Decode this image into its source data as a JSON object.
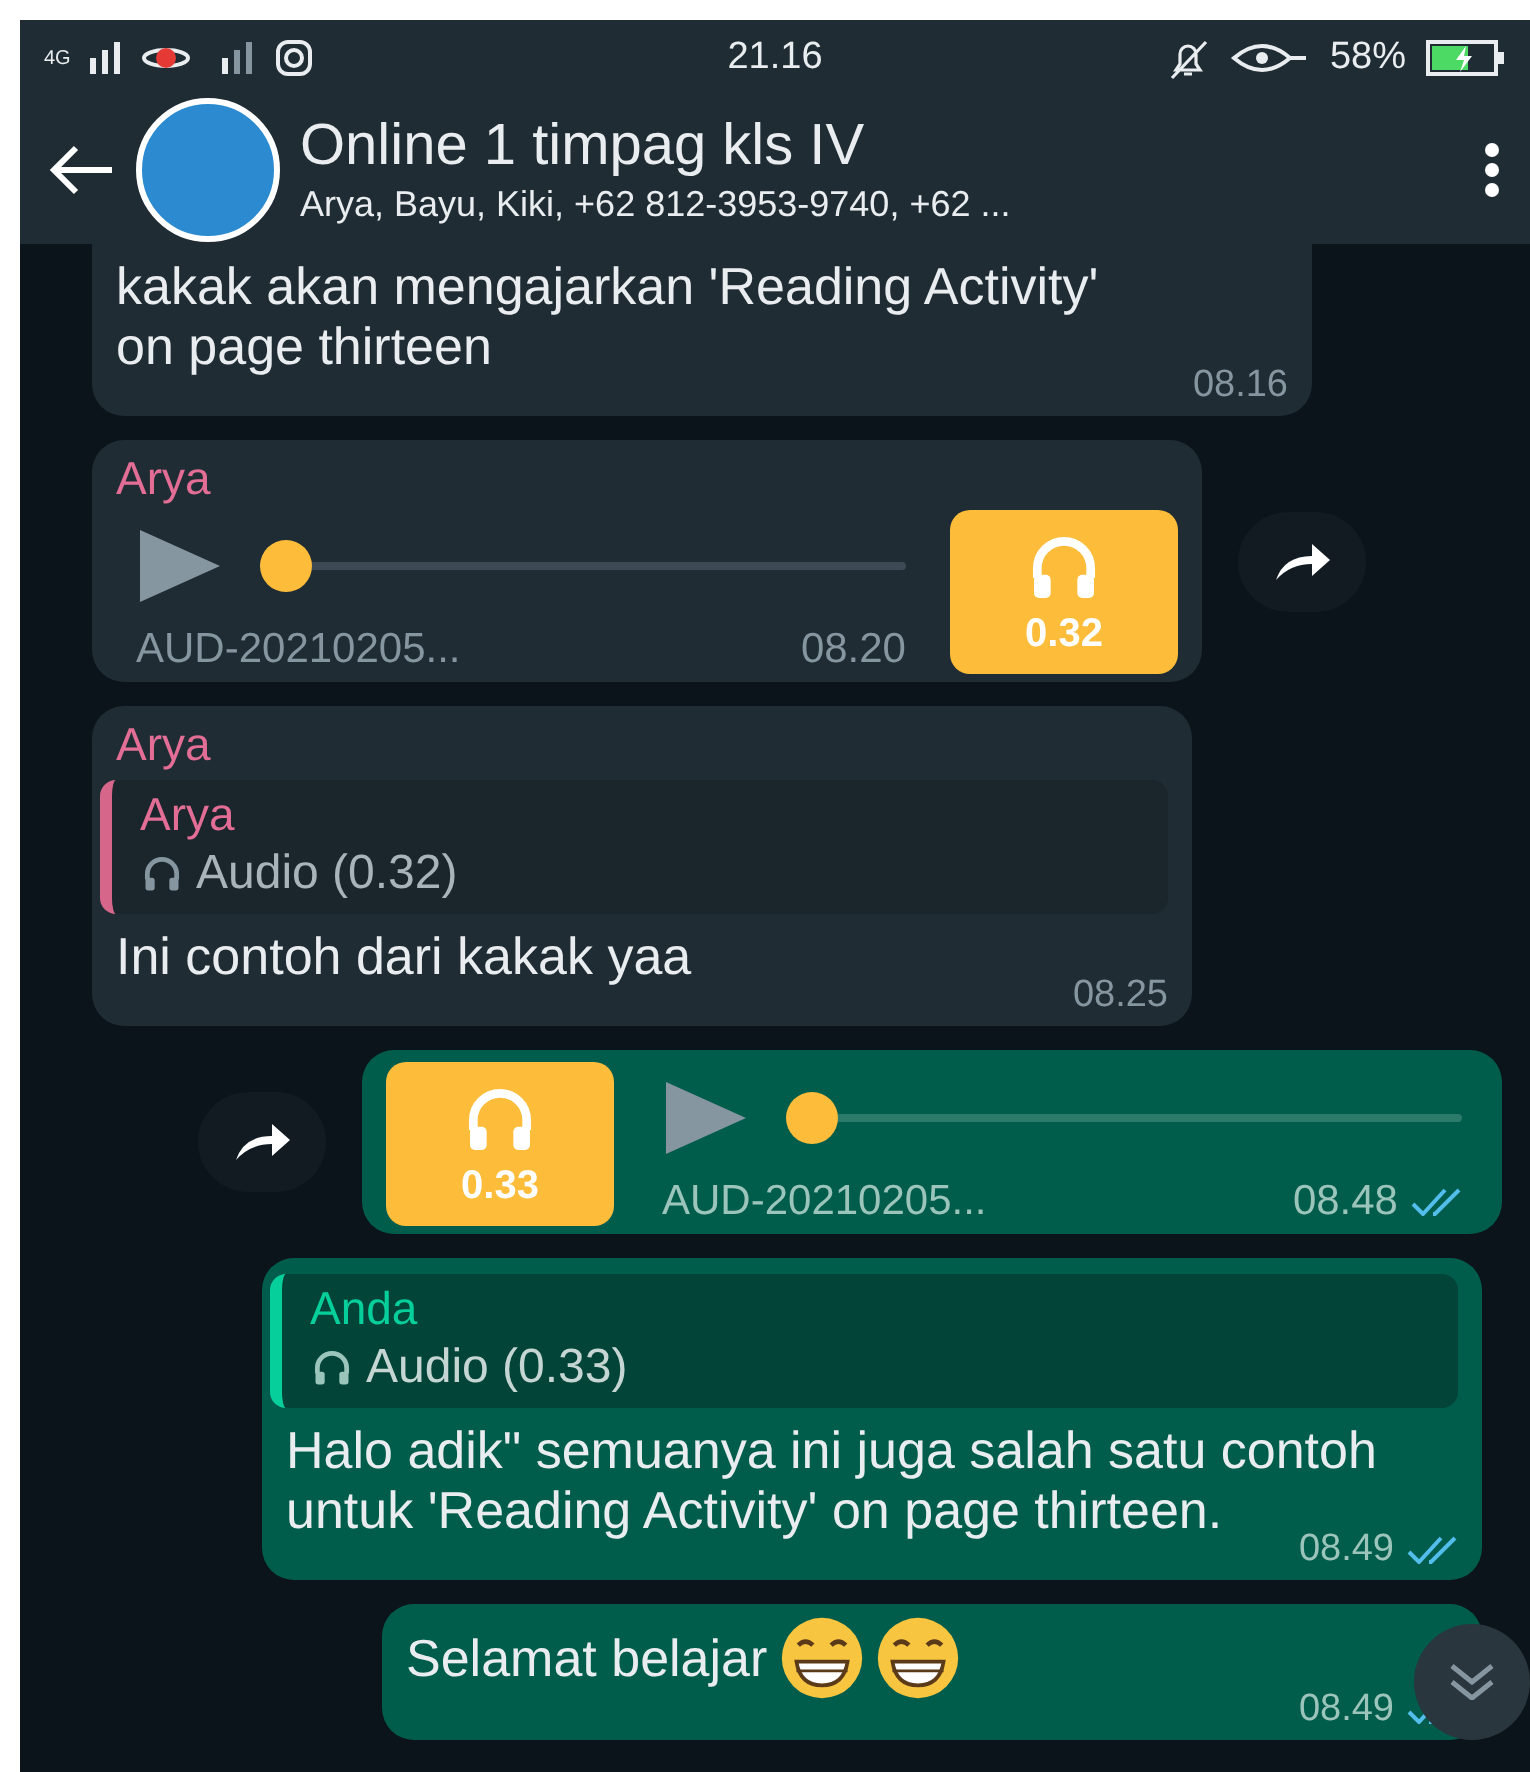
{
  "status_bar": {
    "network_1": "4G",
    "time": "21.16",
    "battery": "58%"
  },
  "header": {
    "title": "Online 1 timpag kls IV",
    "subtitle": "Arya, Bayu, Kiki, +62 812-3953-9740, +62 ..."
  },
  "messages": [
    {
      "kind": "text",
      "outgoing": false,
      "text": "kakak akan mengajarkan 'Reading Activity' on page thirteen",
      "time": "08.16"
    },
    {
      "kind": "audio",
      "outgoing": false,
      "sender": "Arya",
      "file": "AUD-20210205...",
      "time": "08.20",
      "duration": "0.32",
      "level": 0
    },
    {
      "kind": "reply",
      "outgoing": false,
      "sender": "Arya",
      "quote_sender": "Arya",
      "quote_text": "Audio (0.32)",
      "text": "Ini contoh dari kakak yaa",
      "time": "08.25"
    },
    {
      "kind": "audio",
      "outgoing": true,
      "file": "AUD-20210205...",
      "time": "08.48",
      "duration": "0.33",
      "level": 0,
      "read": true
    },
    {
      "kind": "reply",
      "outgoing": true,
      "quote_sender": "Anda",
      "quote_text": "Audio (0.33)",
      "text": "Halo adik\" semuanya ini juga salah satu contoh untuk 'Reading Activity' on page thirteen.",
      "time": "08.49",
      "read": true
    },
    {
      "kind": "text",
      "outgoing": true,
      "text": "Selamat belajar",
      "emojis": [
        {
          "kind": "grin"
        },
        {
          "kind": "grin"
        }
      ],
      "time": "08.49",
      "read": true
    }
  ]
}
